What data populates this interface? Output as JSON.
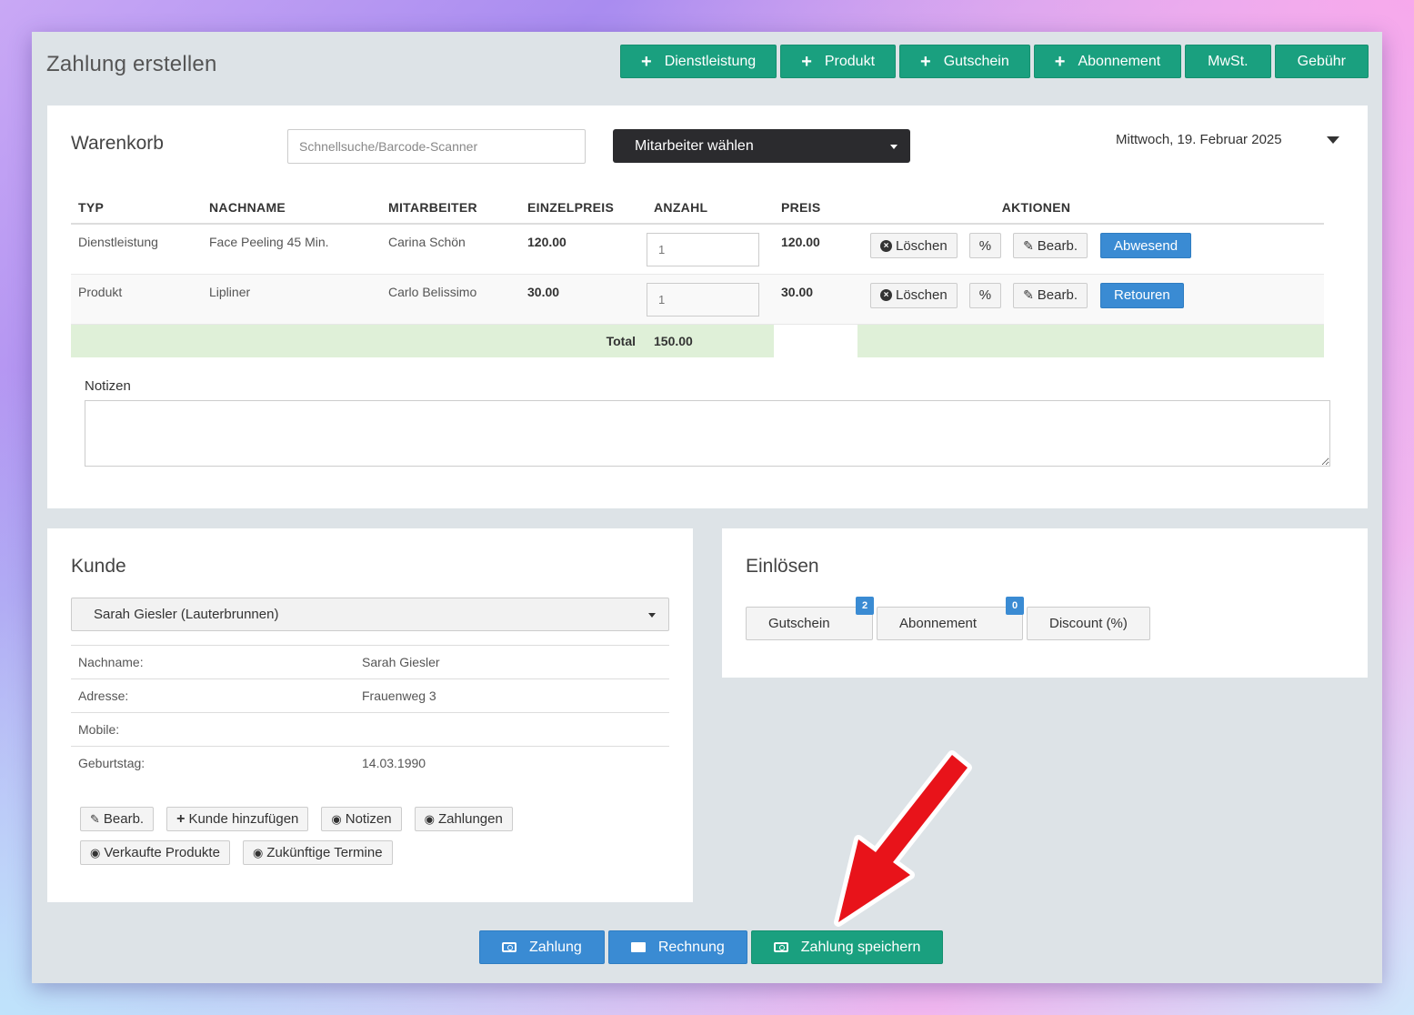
{
  "page": {
    "title": "Zahlung erstellen",
    "top_buttons": [
      {
        "label": "Dienstleistung",
        "icon": "plus-icon"
      },
      {
        "label": "Produkt",
        "icon": "plus-icon"
      },
      {
        "label": "Gutschein",
        "icon": "plus-icon"
      },
      {
        "label": "Abonnement",
        "icon": "plus-icon"
      },
      {
        "label": "MwSt.",
        "icon": ""
      },
      {
        "label": "Gebühr",
        "icon": ""
      }
    ]
  },
  "cart": {
    "title": "Warenkorb",
    "search_placeholder": "Schnellsuche/Barcode-Scanner",
    "staff_select": "Mitarbeiter wählen",
    "date": "Mittwoch, 19. Februar 2025",
    "columns": [
      "TYP",
      "NACHNAME",
      "MITARBEITER",
      "EINZELPREIS",
      "ANZAHL",
      "PREIS",
      "AKTIONEN"
    ],
    "rows": [
      {
        "typ": "Dienstleistung",
        "name": "Face Peeling 45 Min.",
        "staff": "Carina Schön",
        "unit_price": "120.00",
        "qty": "1",
        "price": "120.00",
        "delete": "Löschen",
        "percent": "%",
        "edit": "Bearb.",
        "status": "Abwesend"
      },
      {
        "typ": "Produkt",
        "name": "Lipliner",
        "staff": "Carlo Belissimo",
        "unit_price": "30.00",
        "qty": "1",
        "price": "30.00",
        "delete": "Löschen",
        "percent": "%",
        "edit": "Bearb.",
        "status": "Retouren"
      }
    ],
    "total_label": "Total",
    "total_value": "150.00",
    "notes_label": "Notizen"
  },
  "customer": {
    "title": "Kunde",
    "selected": "Sarah Giesler (Lauterbrunnen)",
    "fields": [
      {
        "key": "Nachname:",
        "value": "Sarah Giesler"
      },
      {
        "key": "Adresse:",
        "value": "Frauenweg 3"
      },
      {
        "key": "Mobile:",
        "value": ""
      },
      {
        "key": "Geburtstag:",
        "value": "14.03.1990"
      }
    ],
    "buttons": {
      "edit": "Bearb.",
      "add_customer": "Kunde hinzufügen",
      "notes": "Notizen",
      "payments": "Zahlungen",
      "sold_products": "Verkaufte Produkte",
      "future_appointments": "Zukünftige Termine"
    }
  },
  "redeem": {
    "title": "Einlösen",
    "voucher": {
      "label": "Gutschein",
      "badge": "2"
    },
    "subscription": {
      "label": "Abonnement",
      "badge": "0"
    },
    "discount": {
      "label": "Discount (%)"
    }
  },
  "bottom": {
    "payment": "Zahlung",
    "invoice": "Rechnung",
    "save_payment": "Zahlung speichern"
  },
  "colors": {
    "green": "#1aa07f",
    "blue": "#3a8bd3",
    "dark": "#2b2b2e",
    "total_bg": "#dff0d8",
    "arrow": "#e8131a"
  }
}
